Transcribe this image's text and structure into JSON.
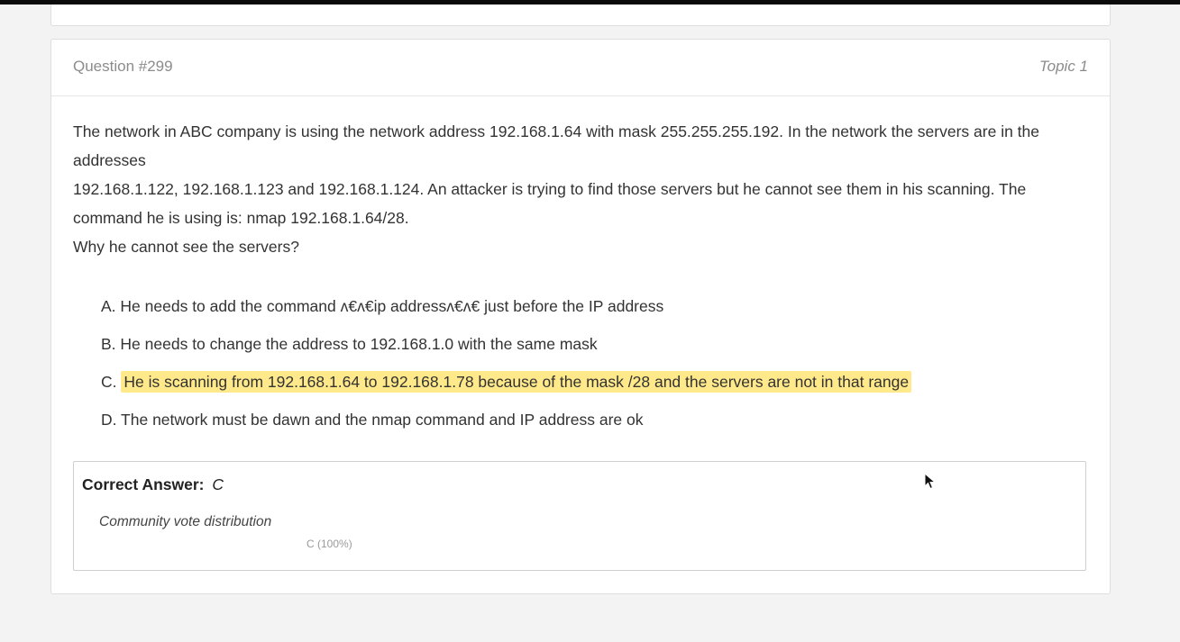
{
  "question": {
    "number_label": "Question #299",
    "topic_label": "Topic 1",
    "text_lines": [
      "The network in ABC company is using the network address 192.168.1.64 with mask 255.255.255.192. In the network the servers are in the",
      "addresses",
      "192.168.1.122, 192.168.1.123 and 192.168.1.124. An attacker is trying to find those servers but he cannot see them in his scanning. The",
      "command he is using is: nmap 192.168.1.64/28.",
      "Why he cannot see the servers?"
    ]
  },
  "choices": [
    {
      "letter": "A.",
      "text": "He needs to add the command ʌ€ʌ€ip addressʌ€ʌ€ just before the IP address",
      "highlighted": false
    },
    {
      "letter": "B.",
      "text": "He needs to change the address to 192.168.1.0 with the same mask",
      "highlighted": false
    },
    {
      "letter": "C.",
      "text": "He is scanning from 192.168.1.64 to 192.168.1.78 because of the mask /28 and the servers are not in that range",
      "highlighted": true
    },
    {
      "letter": "D.",
      "text": "The network must be dawn and the nmap command and IP address are ok",
      "highlighted": false
    }
  ],
  "answer": {
    "label": "Correct Answer:",
    "value": "C",
    "vote_title": "Community vote distribution",
    "vote_bar_label": "C (100%)",
    "vote_share": 1.0
  },
  "colors": {
    "highlight": "#ffe98a",
    "muted_text": "#8c8c8c",
    "body_text": "#333333"
  },
  "icons": {
    "cursor": "mouse-pointer-icon"
  }
}
